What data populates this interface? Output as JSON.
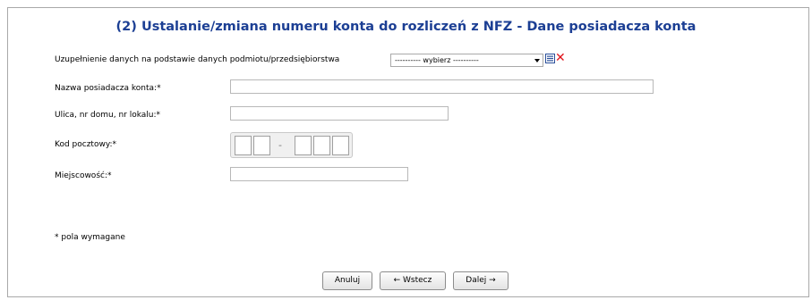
{
  "page": {
    "title": "(2) Ustalanie/zmiana numeru konta do rozliczeń z NFZ - Dane posiadacza konta"
  },
  "prefill": {
    "label": "Uzupełnienie danych na podstawie danych podmiotu/przedsiębiorstwa",
    "select_value": "---------- wybierz ----------",
    "list_icon": "list-icon",
    "clear_icon": "clear-icon",
    "clear_symbol": "✕",
    "clear_color": "#e0141c"
  },
  "fields": {
    "owner_name_label": "Nazwa posiadacza konta:*",
    "owner_name_value": "",
    "street_label": "Ulica, nr domu, nr lokalu:*",
    "street_value": "",
    "postal_label": "Kod pocztowy:*",
    "postal_separator": "-",
    "postal_digits": [
      "",
      "",
      "",
      "",
      ""
    ],
    "city_label": "Miejscowość:*",
    "city_value": ""
  },
  "footnote": "* pola wymagane",
  "buttons": {
    "cancel": "Anuluj",
    "back": "← Wstecz",
    "next": "Dalej →"
  },
  "colors": {
    "title": "#1c3f94",
    "border": "#a9a9a9"
  }
}
